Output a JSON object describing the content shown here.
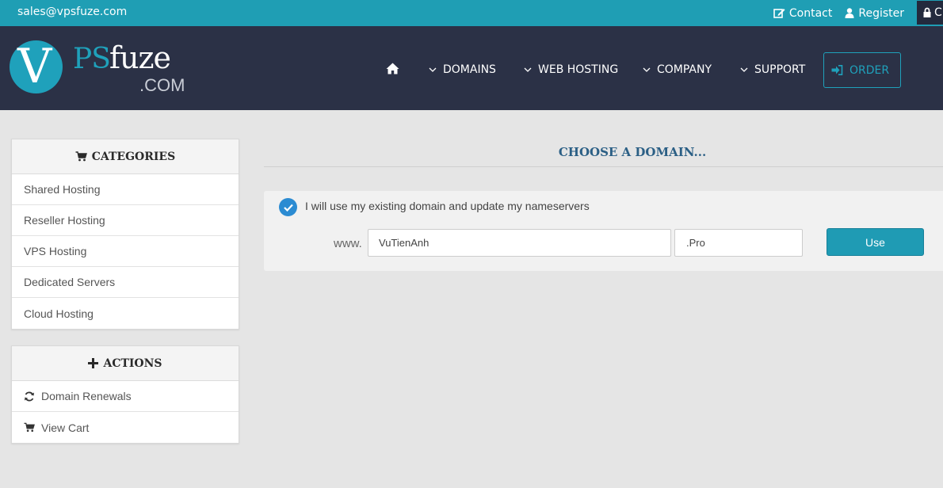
{
  "topbar": {
    "email": "sales@vpsfuze.com",
    "contact": "Contact",
    "register": "Register",
    "login_partial": "C"
  },
  "logo": {
    "v": "V",
    "ps": "PS",
    "fuze": "fuze",
    "com": ".COM"
  },
  "nav": {
    "home_icon": "home-icon",
    "items": [
      "DOMAINS",
      "WEB HOSTING",
      "COMPANY",
      "SUPPORT"
    ],
    "order": "ORDER"
  },
  "categories": {
    "title": "CATEGORIES",
    "items": [
      "Shared Hosting",
      "Reseller Hosting",
      "VPS Hosting",
      "Dedicated Servers",
      "Cloud Hosting"
    ]
  },
  "actions": {
    "title": "ACTIONS",
    "items": [
      "Domain Renewals",
      "View Cart"
    ]
  },
  "main": {
    "title": "CHOOSE A DOMAIN...",
    "option_label": "I will use my existing domain and update my nameservers",
    "www": "www.",
    "sld_value": "VuTienAnh",
    "tld_value": ".Pro",
    "use_button": "Use"
  },
  "colors": {
    "topbar": "#1f9eb4",
    "header": "#2b3146",
    "accent": "#1fa1bb",
    "title": "#2b5f85",
    "check": "#2b8bd2"
  }
}
